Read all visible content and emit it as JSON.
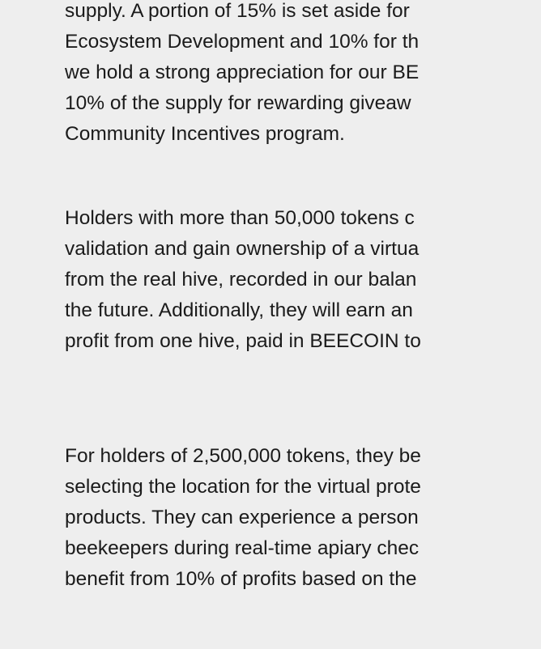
{
  "paragraphs": [
    {
      "lines": [
        "supply. A portion of 15% is set aside for",
        "Ecosystem Development and 10% for th",
        "we hold a strong appreciation for our BE",
        "10% of the supply for rewarding giveaw",
        "Community Incentives program."
      ]
    },
    {
      "lines": [
        "Holders with more than 50,000 tokens c",
        "validation and gain ownership of a virtua",
        "from the real hive, recorded in our balan",
        "the future. Additionally, they will earn an",
        "profit from one hive, paid in BEECOIN to"
      ]
    },
    {
      "lines": [
        "For holders of 2,500,000 tokens, they be",
        "selecting the location for the virtual prote",
        "products. They can experience a person",
        "beekeepers during real-time apiary chec",
        "benefit from 10% of profits based on the"
      ]
    }
  ]
}
